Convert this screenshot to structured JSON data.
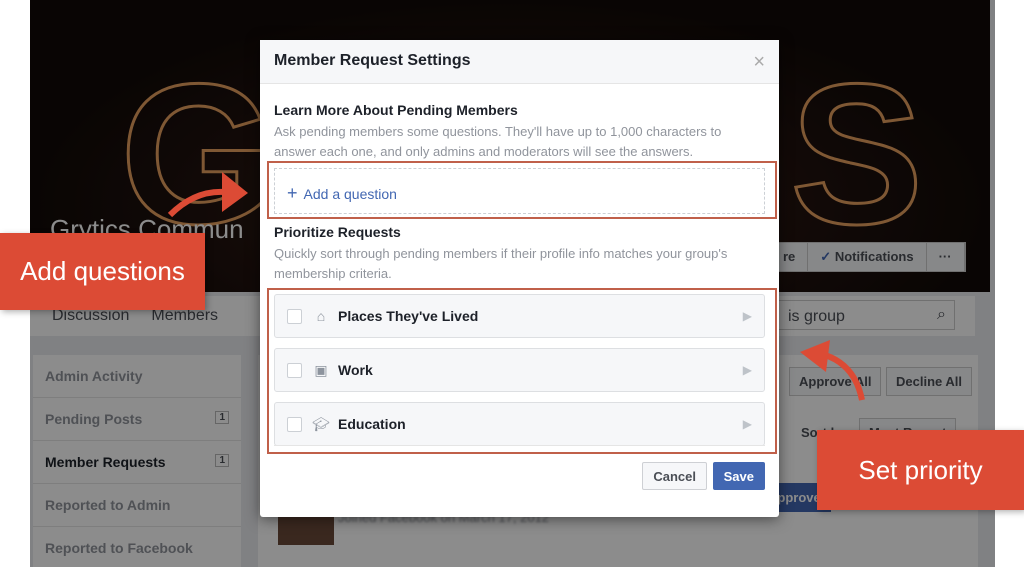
{
  "background": {
    "group_name": "Grytics Commun",
    "cover_buttons": [
      "re",
      "Notifications",
      "···"
    ],
    "nav": [
      "Discussion",
      "Members"
    ],
    "search_placeholder": "is group",
    "sidebar": [
      {
        "label": "Admin Activity",
        "count": ""
      },
      {
        "label": "Pending Posts",
        "count": "1"
      },
      {
        "label": "Member Requests",
        "count": "1",
        "active": true
      },
      {
        "label": "Reported to Admin",
        "count": ""
      },
      {
        "label": "Reported to Facebook",
        "count": ""
      }
    ],
    "approve_all": "Approve All",
    "decline_all": "Decline All",
    "sort_by": "Sort by",
    "sort_value": "Most Recent",
    "approve": "Approve",
    "member_info": "Joined Facebook on March 17, 2012"
  },
  "modal": {
    "title": "Member Request Settings",
    "close": "×",
    "learn_title": "Learn More About Pending Members",
    "learn_desc": "Ask pending members some questions. They'll have up to 1,000 characters to answer each one, and only admins and moderators will see the answers.",
    "add_question": "Add a question",
    "prioritize_title": "Prioritize Requests",
    "prioritize_desc": "Quickly sort through pending members if their profile info matches your group's membership criteria.",
    "criteria": [
      {
        "label": "Places They've Lived",
        "icon": "home-icon",
        "checked": false
      },
      {
        "label": "Work",
        "icon": "briefcase-icon",
        "checked": false
      },
      {
        "label": "Education",
        "icon": "graduation-cap-icon",
        "checked": false
      }
    ],
    "cancel": "Cancel",
    "save": "Save"
  },
  "annotations": {
    "add_questions": "Add questions",
    "set_priority": "Set priority",
    "color": "#dc4b35"
  }
}
